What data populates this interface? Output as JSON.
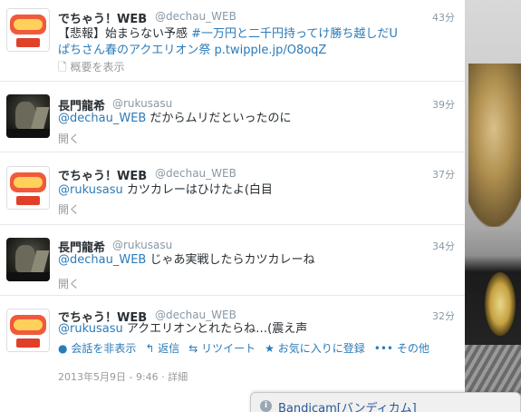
{
  "tweets": [
    {
      "name": "でちゃう！WEB",
      "handle": "@dechau_WEB",
      "time": "43分",
      "text_prefix": "【悲報】始まらない予感 ",
      "hashtag": "#一万円と二千円持ってけ勝ち越しだU",
      "line2_hashtag": "ぱちさん春のアクエリオン祭",
      "line2_link": "p.twipple.jp/O8oqZ",
      "summary": "概要を表示"
    },
    {
      "name": "長門龍希",
      "handle": "@rukusasu",
      "time": "39分",
      "mention": "@dechau_WEB",
      "text": " だからムリだといったのに",
      "expand": "開く"
    },
    {
      "name": "でちゃう！WEB",
      "handle": "@dechau_WEB",
      "time": "37分",
      "mention": "@rukusasu",
      "text": " カツカレーはひけたよ(白目",
      "expand": "開く"
    },
    {
      "name": "長門龍希",
      "handle": "@rukusasu",
      "time": "34分",
      "mention": "@dechau_WEB",
      "text": " じゃあ実戦したらカツカレーね",
      "expand": "開く"
    },
    {
      "name": "でちゃう！WEB",
      "handle": "@dechau_WEB",
      "time": "32分",
      "mention": "@rukusasu",
      "text": " アクエリオンとれたらね…(震え声",
      "actions": {
        "hide_conversation": "会話を非表示",
        "reply": "返信",
        "retweet": "リツイート",
        "favorite": "お気に入りに登録",
        "more": "その他"
      },
      "timestamp": "2013年5月9日 - 9:46",
      "detail": "詳細"
    }
  ],
  "bandicam": {
    "title": "Bandicam[バンディカム]"
  }
}
